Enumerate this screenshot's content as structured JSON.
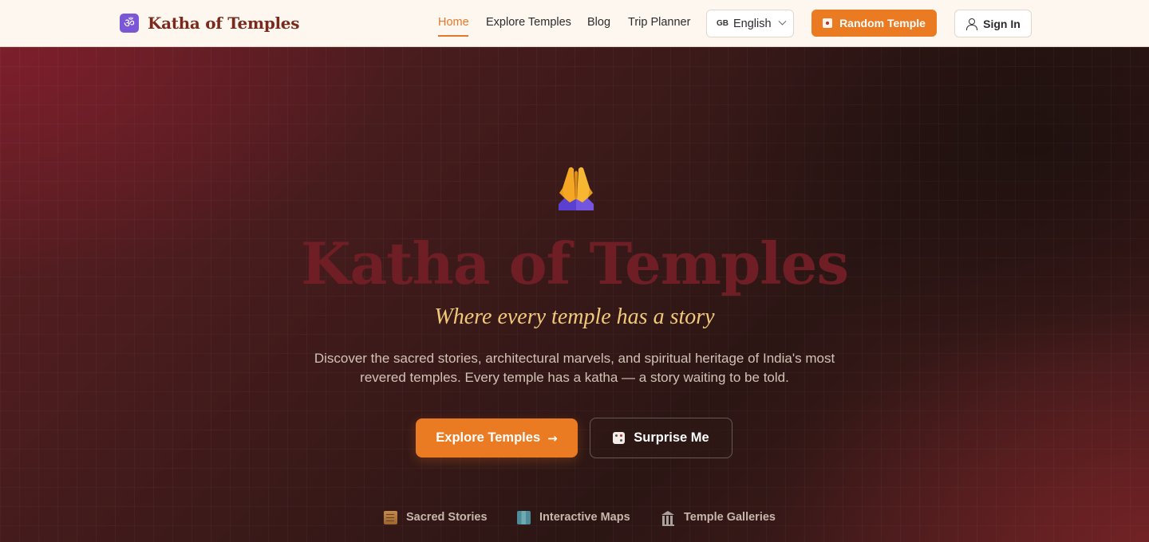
{
  "brand": {
    "logo_glyph": "ॐ",
    "name": "Katha of Temples"
  },
  "nav": {
    "links": [
      {
        "label": "Home",
        "active": true
      },
      {
        "label": "Explore Temples",
        "active": false
      },
      {
        "label": "Blog",
        "active": false
      },
      {
        "label": "Trip Planner",
        "active": false
      }
    ],
    "language": {
      "flag_code": "GB",
      "label": "English"
    },
    "random_temple_label": "Random Temple",
    "sign_in_label": "Sign In"
  },
  "hero": {
    "emoji": "folded-hands",
    "title": "Katha of Temples",
    "tagline": "Where every temple has a story",
    "description": "Discover the sacred stories, architectural marvels, and spiritual heritage of India's most revered temples. Every temple has a katha — a story waiting to be told.",
    "primary_cta": "Explore Temples",
    "primary_cta_arrow": "→",
    "secondary_cta": "Surprise Me",
    "features": [
      {
        "icon": "scroll-icon",
        "label": "Sacred Stories"
      },
      {
        "icon": "map-icon",
        "label": "Interactive Maps"
      },
      {
        "icon": "temple-icon",
        "label": "Temple Galleries"
      }
    ]
  },
  "colors": {
    "accent": "#ea7b22",
    "brand_text": "#7a2a1c",
    "tagline": "#f2c97a",
    "title": "#6e1e24",
    "logo_bg": "#7b57d6"
  }
}
